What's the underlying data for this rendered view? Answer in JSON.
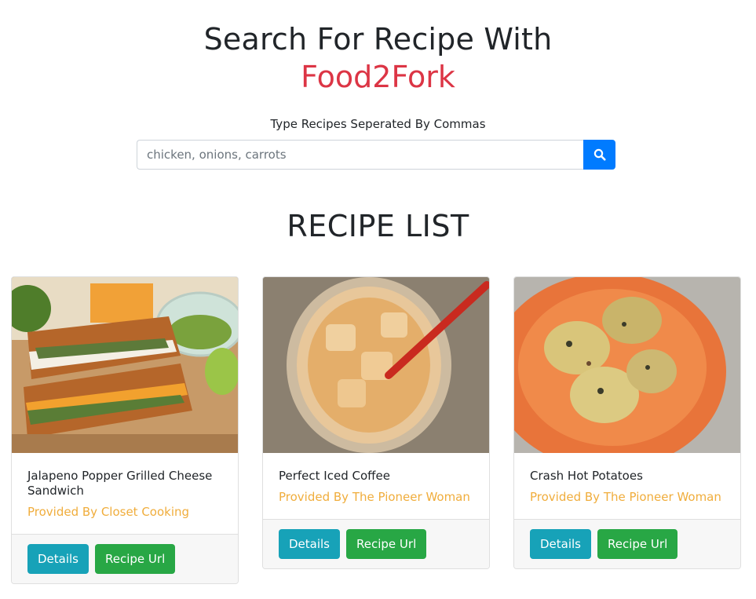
{
  "header": {
    "title_line1": "Search For Recipe With",
    "title_line2": "Food2Fork",
    "search_label": "Type Recipes Seperated By Commas"
  },
  "search": {
    "placeholder": "chicken, onions, carrots",
    "value": "",
    "button_icon": "search-icon"
  },
  "recipe_list": {
    "title": "RECIPE LIST",
    "recipes": [
      {
        "title": "Jalapeno Popper Grilled Cheese Sandwich",
        "publisher": "Provided By Closet Cooking",
        "details_label": "Details",
        "url_label": "Recipe Url"
      },
      {
        "title": "Perfect Iced Coffee",
        "publisher": "Provided By The Pioneer Woman",
        "details_label": "Details",
        "url_label": "Recipe Url"
      },
      {
        "title": "Crash Hot Potatoes",
        "publisher": "Provided By The Pioneer Woman",
        "details_label": "Details",
        "url_label": "Recipe Url"
      }
    ]
  },
  "colors": {
    "brand_red": "#dc3545",
    "primary_blue": "#007bff",
    "info_teal": "#17a2b8",
    "success_green": "#28a745",
    "publisher_orange": "#f0ad3c"
  }
}
